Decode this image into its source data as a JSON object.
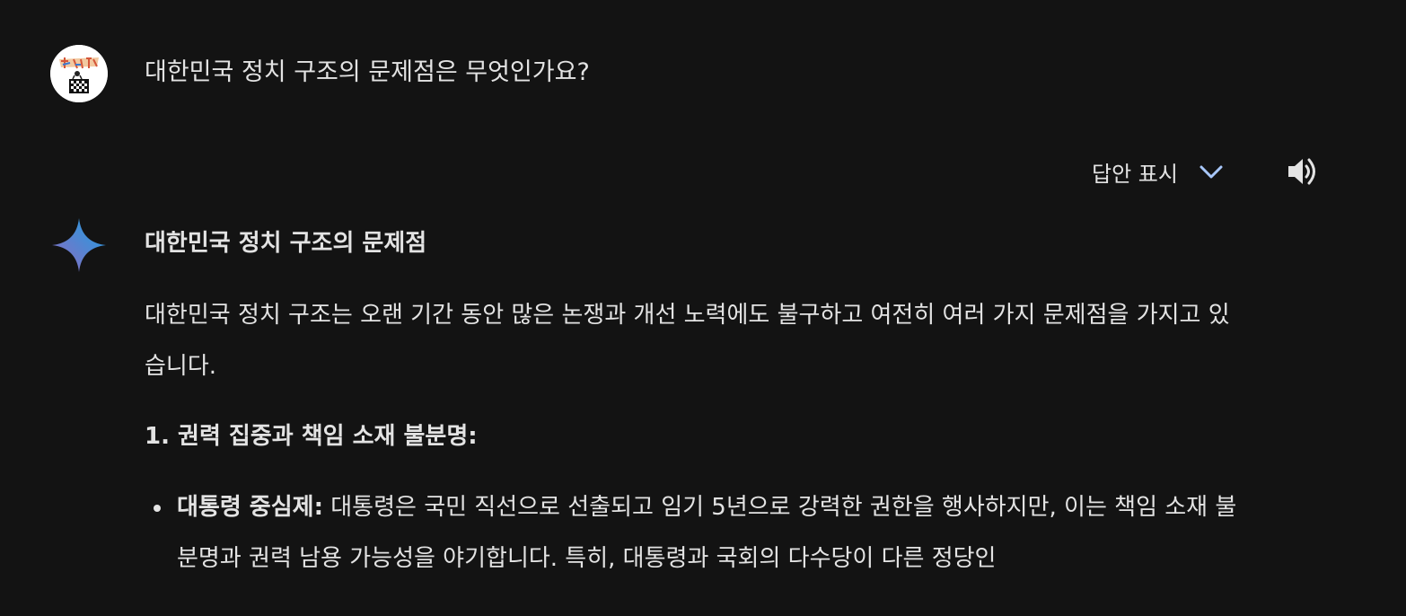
{
  "user_prompt": {
    "text": "대한민국 정치 구조의 문제점은 무엇인가요?"
  },
  "toolbar": {
    "show_drafts_label": "답안 표시"
  },
  "response": {
    "title": "대한민국 정치 구조의 문제점",
    "intro": "대한민국 정치 구조는 오랜 기간 동안 많은 논쟁과 개선 노력에도 불구하고 여전히 여러 가지 문제점을 가지고 있습니다.",
    "section_1_heading": "1. 권력 집중과 책임 소재 불분명:",
    "bullets": [
      {
        "term": "대통령 중심제:",
        "text": " 대통령은 국민 직선으로 선출되고 임기 5년으로 강력한 권한을 행사하지만, 이는 책임 소재 불분명과 권력 남용 가능성을 야기합니다. 특히, 대통령과 국회의 다수당이 다른 정당인"
      }
    ]
  },
  "colors": {
    "background": "#131313",
    "text": "#e3e3e3",
    "accent": "#a8c7fa"
  },
  "icons": {
    "avatar": "user-avatar",
    "chevron": "chevron-down-icon",
    "speaker": "speaker-icon",
    "sparkle": "gemini-sparkle-icon"
  }
}
